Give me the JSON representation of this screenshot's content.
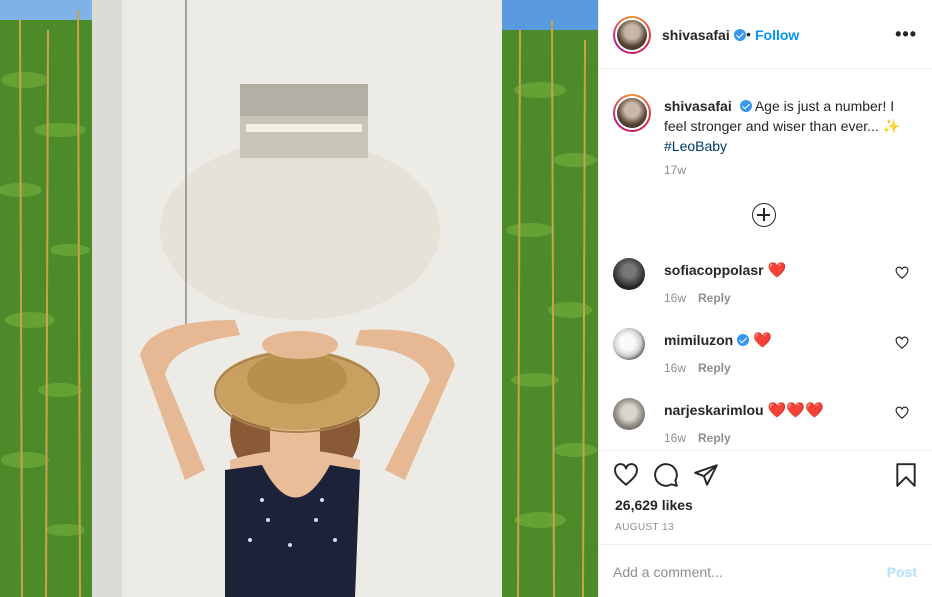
{
  "post": {
    "image_alt": "Woman in straw hat and black swimsuit against white wall",
    "author": {
      "username": "shivasafai",
      "verified": true,
      "separator": "•",
      "follow_label": "Follow"
    },
    "more_icon": "more-options-icon",
    "more_glyph": "•••",
    "caption": {
      "username": "shivasafai",
      "text": "Age is just a number! I feel stronger and wiser than ever... ✨",
      "hashtag": "#LeoBaby",
      "time": "17w"
    },
    "load_more_icon": "plus-circle-icon",
    "comments": [
      {
        "username": "sofiacoppolasr",
        "verified": false,
        "text": "❤️",
        "time": "16w",
        "reply_label": "Reply"
      },
      {
        "username": "mimiluzon",
        "verified": true,
        "text": "❤️",
        "time": "16w",
        "reply_label": "Reply"
      },
      {
        "username": "narjeskarimlou",
        "verified": false,
        "text": "❤️❤️❤️",
        "time": "16w",
        "reply_label": "Reply"
      }
    ],
    "actions": {
      "like_icon": "heart-icon",
      "comment_icon": "comment-icon",
      "share_icon": "share-icon",
      "save_icon": "bookmark-icon"
    },
    "likes": "26,629 likes",
    "date": "AUGUST 13",
    "add_comment": {
      "placeholder": "Add a comment...",
      "post_label": "Post"
    }
  },
  "colors": {
    "follow_blue": "#0095f6",
    "verified_blue": "#3897f0",
    "post_disabled": "#b2dffc",
    "heart_red": "#ed4956",
    "muted_gray": "#8e8e8e",
    "border": "#efefef"
  }
}
